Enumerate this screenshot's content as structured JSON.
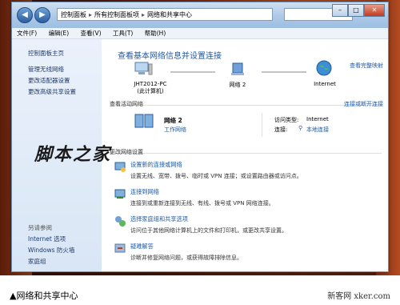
{
  "window_title_fragment": "...控制面板",
  "address_bar": {
    "segments": [
      "控制面板",
      "所有控制面板项",
      "网络和共享中心"
    ]
  },
  "menu": {
    "file": "文件(F)",
    "edit": "编辑(E)",
    "view": "查看(V)",
    "tools": "工具(T)",
    "help": "帮助(H)"
  },
  "sidebar": {
    "items": [
      {
        "label": "控制面板主页"
      },
      {
        "label": "管理无线网络"
      },
      {
        "label": "更改适配器设置"
      },
      {
        "label": "更改高级共享设置"
      }
    ],
    "see_also_label": "另请参阅",
    "see_also": [
      {
        "label": "Internet 选项"
      },
      {
        "label": "Windows 防火墙"
      },
      {
        "label": "家庭组"
      }
    ]
  },
  "main": {
    "heading": "查看基本网络信息并设置连接",
    "see_full_map": "查看完整映射",
    "map": {
      "computer_name": "JHT2012-PC",
      "computer_sub": "(此计算机)",
      "network_name": "网络 2",
      "internet": "Internet"
    },
    "active_networks_label": "查看活动网络",
    "connect_disconnect": "连接或断开连接",
    "active": {
      "name": "网络 2",
      "type": "工作网络",
      "access_type_label": "访问类型:",
      "access_type_value": "Internet",
      "connection_label": "连接:",
      "connection_value": "本地连接"
    },
    "change_settings_label": "更改网络设置",
    "tasks": [
      {
        "title": "设置新的连接或网络",
        "desc": "设置无线、宽带、拨号、临时或 VPN 连接；或设置路由器或访问点。"
      },
      {
        "title": "连接到网络",
        "desc": "连接到或重新连接到无线、有线、拨号或 VPN 网络连接。"
      },
      {
        "title": "选择家庭组和共享选项",
        "desc": "访问位于其他网络计算机上的文件和打印机，或更改共享设置。"
      },
      {
        "title": "疑难解答",
        "desc": "诊断并修复网络问题，或获得故障排除信息。"
      }
    ]
  },
  "watermark": "脚本之家",
  "caption": "▲网络和共享中心",
  "credit": "新客网 xker.com",
  "colors": {
    "link": "#1e5aa8",
    "heading": "#1e5aa8",
    "sidebar_bg": "#dfe9f6"
  }
}
